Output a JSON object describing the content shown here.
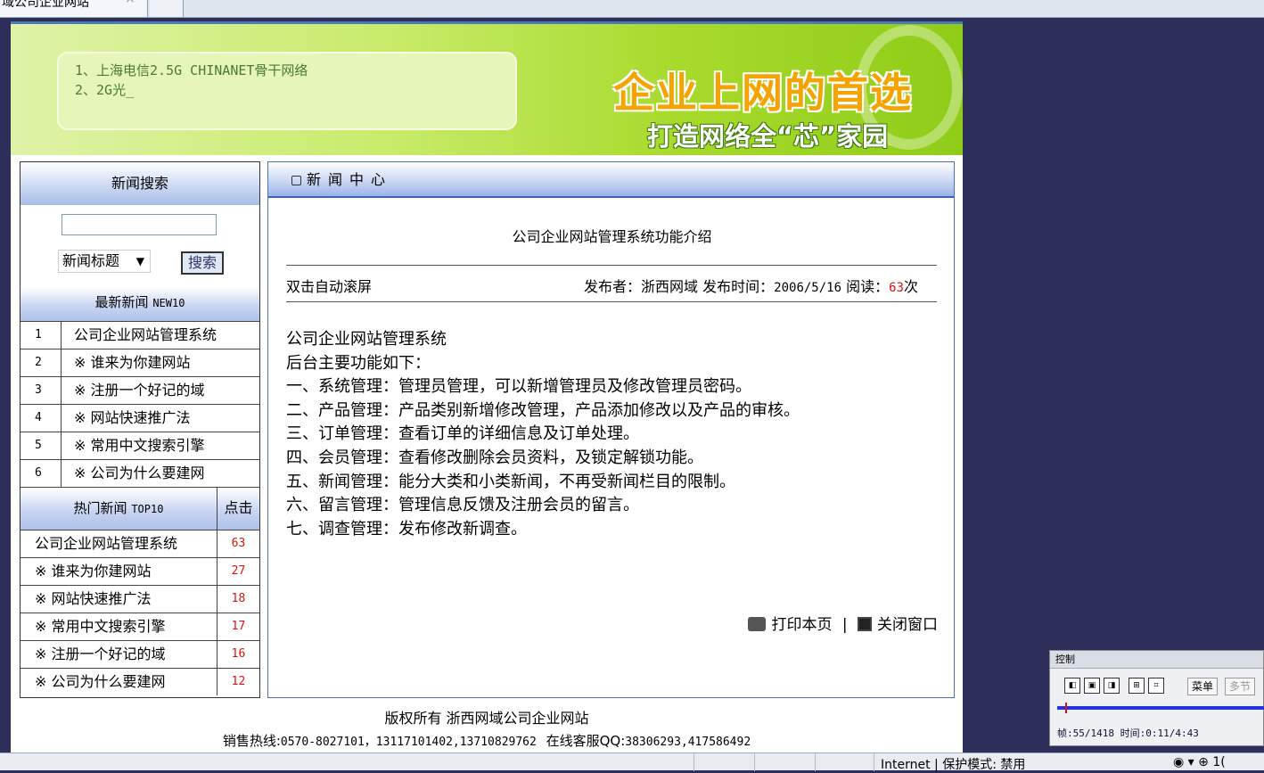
{
  "browser": {
    "tab_title": "域公司企业网站",
    "tab_close": "×",
    "status_zone": "Internet | 保护模式: 禁用",
    "status_zoom": "◉ ▾   ⊕ 1("
  },
  "banner": {
    "notice_lines": [
      "1、上海电信2.5G CHINANET骨干网络",
      "2、2G光_"
    ],
    "slogan_main": "企业上网的首选",
    "slogan_sub": "打造网络全“芯”家园"
  },
  "sidebar": {
    "search_title": "新闻搜索",
    "search_keyword": "",
    "search_field_selected": "新闻标题",
    "search_button": "搜索",
    "latest_title": "最新新闻",
    "latest_suffix": "NEW10",
    "latest_items": [
      {
        "no": "1",
        "title": "公司企业网站管理系统"
      },
      {
        "no": "2",
        "title": "※ 谁来为你建网站"
      },
      {
        "no": "3",
        "title": "※ 注册一个好记的域"
      },
      {
        "no": "4",
        "title": "※ 网站快速推广法"
      },
      {
        "no": "5",
        "title": "※ 常用中文搜索引擎"
      },
      {
        "no": "6",
        "title": "※ 公司为什么要建网"
      }
    ],
    "hot_title": "热门新闻",
    "hot_suffix": "TOP10",
    "hot_clicks_header": "点击",
    "hot_items": [
      {
        "title": "公司企业网站管理系统",
        "clicks": "63"
      },
      {
        "title": "※ 谁来为你建网站",
        "clicks": "27"
      },
      {
        "title": "※ 网站快速推广法",
        "clicks": "18"
      },
      {
        "title": "※ 常用中文搜索引擎",
        "clicks": "17"
      },
      {
        "title": "※ 注册一个好记的域",
        "clicks": "16"
      },
      {
        "title": "※ 公司为什么要建网",
        "clicks": "12"
      }
    ]
  },
  "article": {
    "section_title": "新闻中心",
    "title": "公司企业网站管理系统功能介绍",
    "scroll_hint": "双击自动滚屏",
    "publisher_label": "发布者：",
    "publisher": "浙西网域",
    "time_label": "发布时间：",
    "time": "2006/5/16",
    "reads_label": "阅读：",
    "reads": "63",
    "reads_unit": "次",
    "body_lines": [
      "公司企业网站管理系统",
      "后台主要功能如下：",
      "一、系统管理：管理员管理，可以新增管理员及修改管理员密码。",
      "二、产品管理：产品类别新增修改管理，产品添加修改以及产品的审核。",
      "三、订单管理：查看订单的详细信息及订单处理。",
      "四、会员管理：查看修改删除会员资料，及锁定解锁功能。",
      "五、新闻管理：能分大类和小类新闻，不再受新闻栏目的限制。",
      "六、留言管理：管理信息反馈及注册会员的留言。",
      "七、调查管理：发布修改新调查。"
    ],
    "print_label": "打印本页",
    "divider": "|",
    "close_label": "关闭窗口"
  },
  "footer": {
    "copyright": "版权所有 浙西网域公司企业网站",
    "hotline_label": "销售热线:",
    "hotline": "0570-8027101，13117101402,13710829762",
    "qq_label": "在线客服QQ:",
    "qq": "38306293,417586492"
  },
  "player": {
    "title": "控制",
    "menu_label": "菜单",
    "chapter_label": "多节",
    "info": "帧:55/1418 时间:0:11/4:43",
    "progress": 0.039
  }
}
